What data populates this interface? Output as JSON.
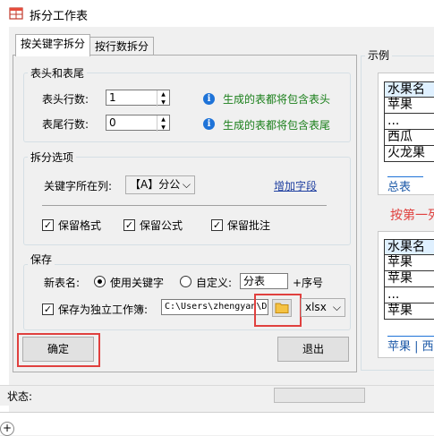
{
  "window": {
    "title": "拆分工作表"
  },
  "tabs": [
    {
      "label": "按关键字拆分"
    },
    {
      "label": "按行数拆分"
    }
  ],
  "header_footer": {
    "legend": "表头和表尾",
    "header_label": "表头行数:",
    "header_value": "1",
    "header_hint": "生成的表都将包含表头",
    "footer_label": "表尾行数:",
    "footer_value": "0",
    "footer_hint": "生成的表都将包含表尾"
  },
  "split_options": {
    "legend": "拆分选项",
    "key_col_label": "关键字所在列:",
    "key_col_value": "【A】分公",
    "add_field_link": "增加字段",
    "keep_format": "保留格式",
    "keep_formula": "保留公式",
    "keep_comment": "保留批注"
  },
  "save": {
    "legend": "保存",
    "new_name_label": "新表名:",
    "use_keyword": "使用关键字",
    "custom_label": "自定义:",
    "custom_value": "分表",
    "seq_suffix": "+序号",
    "save_separate": "保存为独立工作簿:",
    "path_value": "C:\\Users\\zhengyan\\De",
    "format_value": "xlsx"
  },
  "buttons": {
    "ok": "确定",
    "exit": "退出"
  },
  "status": {
    "label": "状态:"
  },
  "example": {
    "legend": "示例",
    "top_rows": [
      "水果名",
      "苹果",
      "...",
      "西瓜",
      "火龙果"
    ],
    "top_tab": "总表",
    "split_label": "按第一列",
    "bottom_rows": [
      "水果名",
      "苹果",
      "苹果",
      "...",
      "苹果"
    ],
    "bottom_tabs": [
      "苹果",
      "西"
    ]
  },
  "colors": {
    "highlight": "#e0403e",
    "hint": "#1a7f1a",
    "info": "#1e73d8",
    "link": "#1f3fa0"
  }
}
